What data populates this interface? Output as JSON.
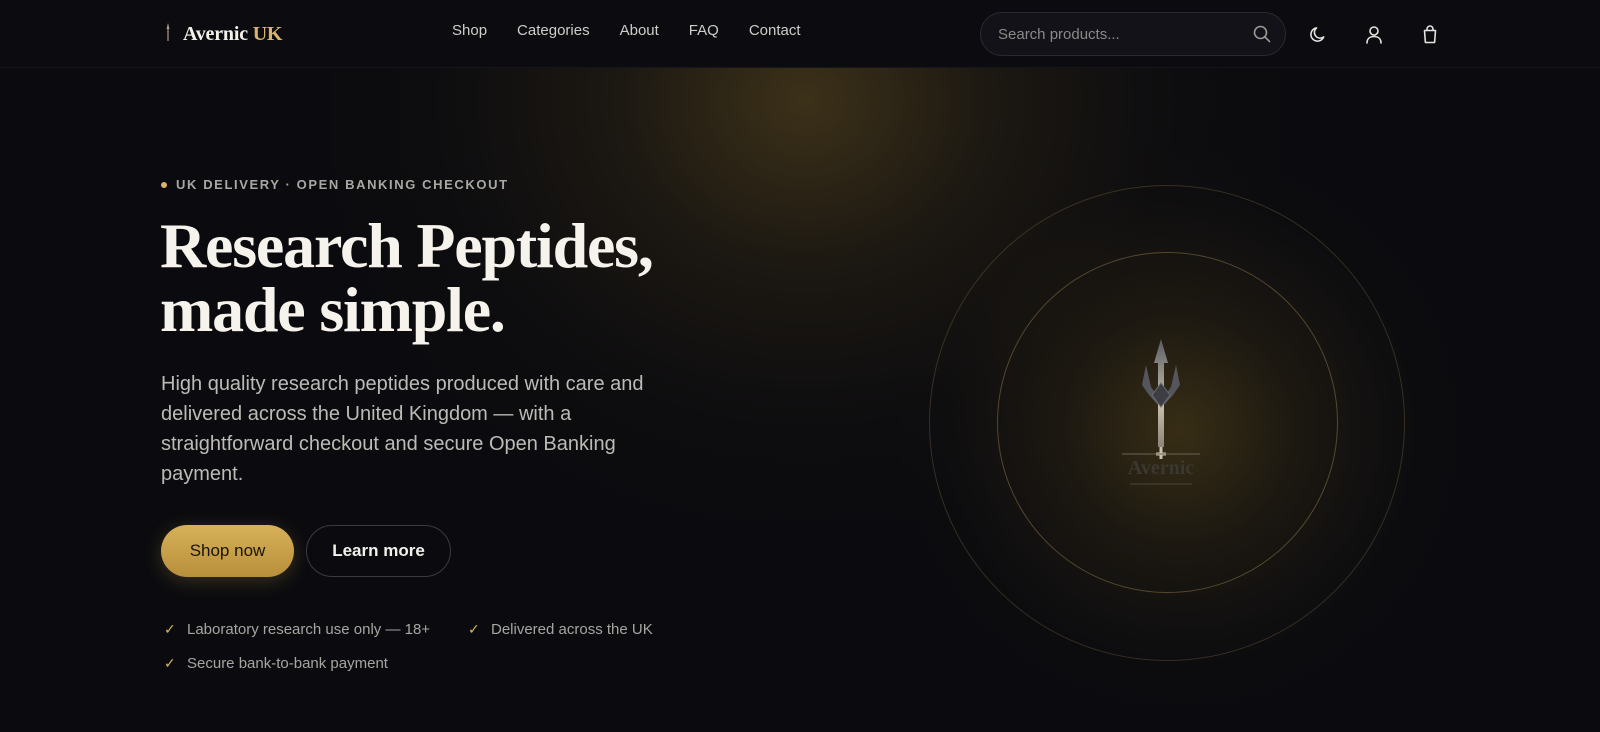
{
  "header": {
    "brand": "Avernic",
    "brand_accent": "UK",
    "nav": [
      "Shop",
      "Categories",
      "About",
      "FAQ",
      "Contact"
    ],
    "search_placeholder": "Search products...",
    "icons": [
      "search-icon",
      "moon-icon",
      "user-icon",
      "bag-icon"
    ]
  },
  "hero": {
    "eyebrow": "UK DELIVERY · OPEN BANKING CHECKOUT",
    "headline_line1": "Research Peptides,",
    "headline_line2": "made simple.",
    "lede": "High quality research peptides produced with care and delivered across the United Kingdom — with a straightforward checkout and secure Open Banking payment.",
    "primary_cta": "Shop now",
    "secondary_cta": "Learn more",
    "features": [
      "Laboratory research use only — 18+",
      "Delivered across the UK",
      "Secure bank-to-bank payment"
    ],
    "emblem_text": "Avernic"
  },
  "colors": {
    "background": "#0b0b0f",
    "accent": "#d8b56a",
    "text": "#f6f3ec"
  }
}
